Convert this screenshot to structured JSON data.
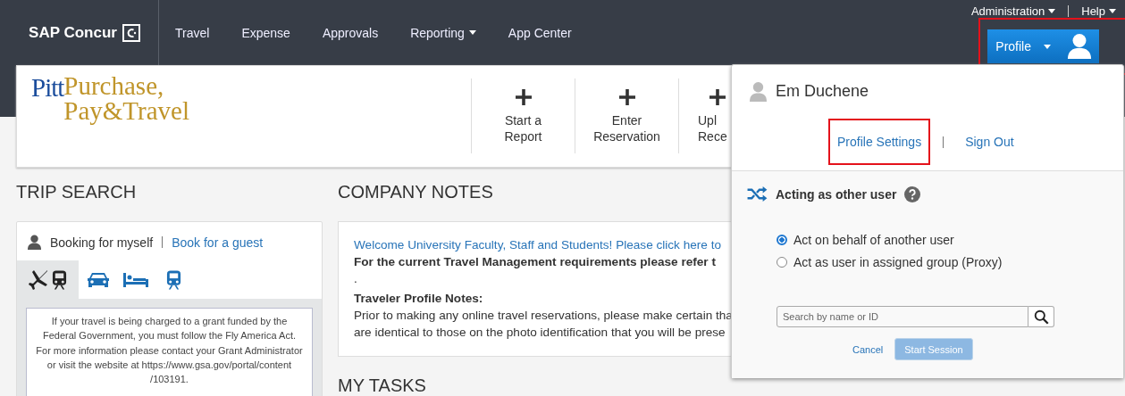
{
  "top_nav": {
    "brand": "SAP Concur",
    "items": [
      {
        "label": "Travel",
        "has_menu": false
      },
      {
        "label": "Expense",
        "has_menu": false
      },
      {
        "label": "Approvals",
        "has_menu": false
      },
      {
        "label": "Reporting",
        "has_menu": true
      },
      {
        "label": "App Center",
        "has_menu": false
      }
    ],
    "utility": [
      {
        "label": "Administration"
      },
      {
        "label": "Help"
      }
    ],
    "profile_button": {
      "label": "Profile"
    }
  },
  "banner": {
    "logo": {
      "mark": "Pitt",
      "line_1": "Purchase,",
      "line_2": "Pay&Travel"
    },
    "actions": [
      {
        "lines": [
          "Start a",
          "Report"
        ]
      },
      {
        "lines": [
          "Enter",
          "Reservation"
        ]
      },
      {
        "lines": [
          "Upl",
          "Rece"
        ]
      }
    ]
  },
  "trip_search": {
    "title": "TRIP SEARCH",
    "booking_for": "Booking for myself",
    "guest_link": "Book for a guest",
    "tabs": [
      {
        "kind": "air-rail",
        "selected": true
      },
      {
        "kind": "car",
        "selected": false
      },
      {
        "kind": "hotel",
        "selected": false
      },
      {
        "kind": "rail",
        "selected": false
      }
    ],
    "notice": [
      "If your travel is being charged to a grant funded by the",
      "Federal Government, you must follow the Fly America Act.",
      "For more information please contact your Grant Administrator",
      "or visit the website at https://www.gsa.gov/portal/content",
      "/103191."
    ]
  },
  "company_notes": {
    "title": "COMPANY NOTES",
    "welcome_link": "Welcome University Faculty, Staff and Students! Please click here to",
    "requirements": "For the current Travel Management requirements please refer t",
    "separator": ".",
    "profile_heading": "Traveler Profile Notes:",
    "profile_text": [
      "Prior to making any online travel reservations, please make certain tha",
      "are identical to those on the photo identification that you will be prese"
    ]
  },
  "my_tasks": {
    "title": "MY TASKS"
  },
  "profile_menu": {
    "user_name": "Em Duchene",
    "links": [
      {
        "label": "Profile Settings",
        "highlighted": true
      },
      {
        "label": "Sign Out",
        "highlighted": false
      }
    ],
    "acting_title": "Acting as other user",
    "options": [
      {
        "label": "Act on behalf of another user",
        "selected": true
      },
      {
        "label": "Act as user in assigned group (Proxy)",
        "selected": false
      }
    ],
    "search": {
      "placeholder": "Search by name or ID"
    },
    "cancel": "Cancel",
    "start": {
      "label": "Start Session",
      "disabled": true
    }
  }
}
